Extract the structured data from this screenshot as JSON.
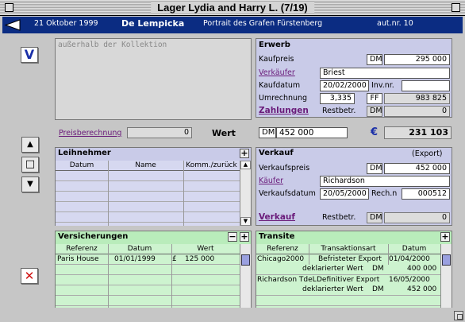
{
  "window": {
    "title": "Lager Lydia and Harry L. (7/19)"
  },
  "navbar": {
    "date": "21 Oktober 1999",
    "artist": "De Lempicka",
    "work_title": "Portrait des Grafen Fürstenberg",
    "aut_nr": "aut.nr. 10"
  },
  "notes": {
    "text": "außerhalb der Kollektion"
  },
  "erwerb": {
    "title": "Erwerb",
    "kaufpreis_label": "Kaufpreis",
    "kaufpreis_currency": "DM",
    "kaufpreis_value": "295 000",
    "verkaeufer_label": "Verkäufer",
    "verkaeufer_value": "Briest",
    "kaufdatum_label": "Kaufdatum",
    "kaufdatum_value": "20/02/2000",
    "invnr_label": "Inv.nr.",
    "invnr_value": "",
    "umrechnung_label": "Umrechnung",
    "umrechnung_value": "3,335",
    "umrechnung_currency": "FF",
    "umrechnung_result": "983 825",
    "zahlungen_label": "Zahlungen",
    "restbetr_label": "Restbetr.",
    "restbetr_currency": "DM",
    "restbetr_value": "0"
  },
  "preis": {
    "link_label": "Preisberechnung",
    "link_value": "0",
    "wert_label": "Wert",
    "wert_currency": "DM",
    "wert_value": "452 000",
    "euro_symbol": "€",
    "euro_value": "231 103"
  },
  "leihnehmer": {
    "title": "Leihnehmer",
    "columns": [
      "Datum",
      "Name",
      "Komm./zurück"
    ],
    "rows": []
  },
  "verkauf": {
    "title": "Verkauf",
    "subtitle": "(Export)",
    "preis_label": "Verkaufspreis",
    "preis_currency": "DM",
    "preis_value": "452 000",
    "kaeufer_label": "Käufer",
    "kaeufer_value": "Richardson",
    "datum_label": "Verkaufsdatum",
    "datum_value": "20/05/2000",
    "rechn_label": "Rech.n",
    "rechn_value": "000512",
    "link_label": "Verkauf",
    "restbetr_label": "Restbetr.",
    "restbetr_currency": "DM",
    "restbetr_value": "0"
  },
  "versicherungen": {
    "title": "Versicherungen",
    "columns": [
      "Referenz",
      "Datum",
      "Wert"
    ],
    "rows": [
      {
        "referenz": "Paris House",
        "datum": "01/01/1999",
        "currency": "£",
        "wert": "125 000"
      }
    ]
  },
  "transite": {
    "title": "Transite",
    "columns": [
      "Referenz",
      "Transaktionsart",
      "Datum"
    ],
    "rows": [
      {
        "referenz": "Chicago2000",
        "art": "Befristeter Export",
        "datum": "01/04/2000",
        "wert_label": "deklarierter Wert",
        "currency": "DM",
        "wert": "400 000"
      },
      {
        "referenz": "Richardson TdeL",
        "art": "Definitiver Export",
        "datum": "16/05/2000",
        "wert_label": "deklarierter Wert",
        "currency": "DM",
        "wert": "452 000"
      }
    ]
  },
  "buttons": {
    "v_label": "V",
    "delete_label": "✕",
    "up_label": "▲",
    "stop_label": "□",
    "down_label": "▼"
  },
  "colors": {
    "navbar": "#0b2c82",
    "blue_panel": "#c9cbe8",
    "green_panel": "#b9ecbb",
    "link": "#6a1b7a",
    "delete": "#d01010"
  }
}
